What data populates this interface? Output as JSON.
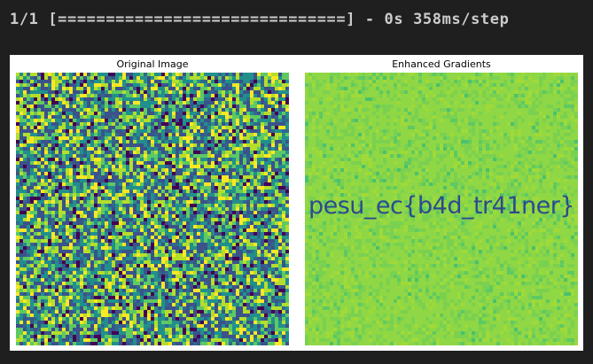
{
  "console": {
    "progress_line": "1/1 [==============================] - 0s 358ms/step"
  },
  "figure": {
    "left_panel": {
      "title": "Original Image"
    },
    "right_panel": {
      "title": "Enhanced Gradients",
      "hidden_text": "pesu_ec{b4d_tr41ner}"
    },
    "colormap": [
      "#440154",
      "#3b528b",
      "#21908c",
      "#5dc963",
      "#b5de2b",
      "#fde725"
    ]
  }
}
